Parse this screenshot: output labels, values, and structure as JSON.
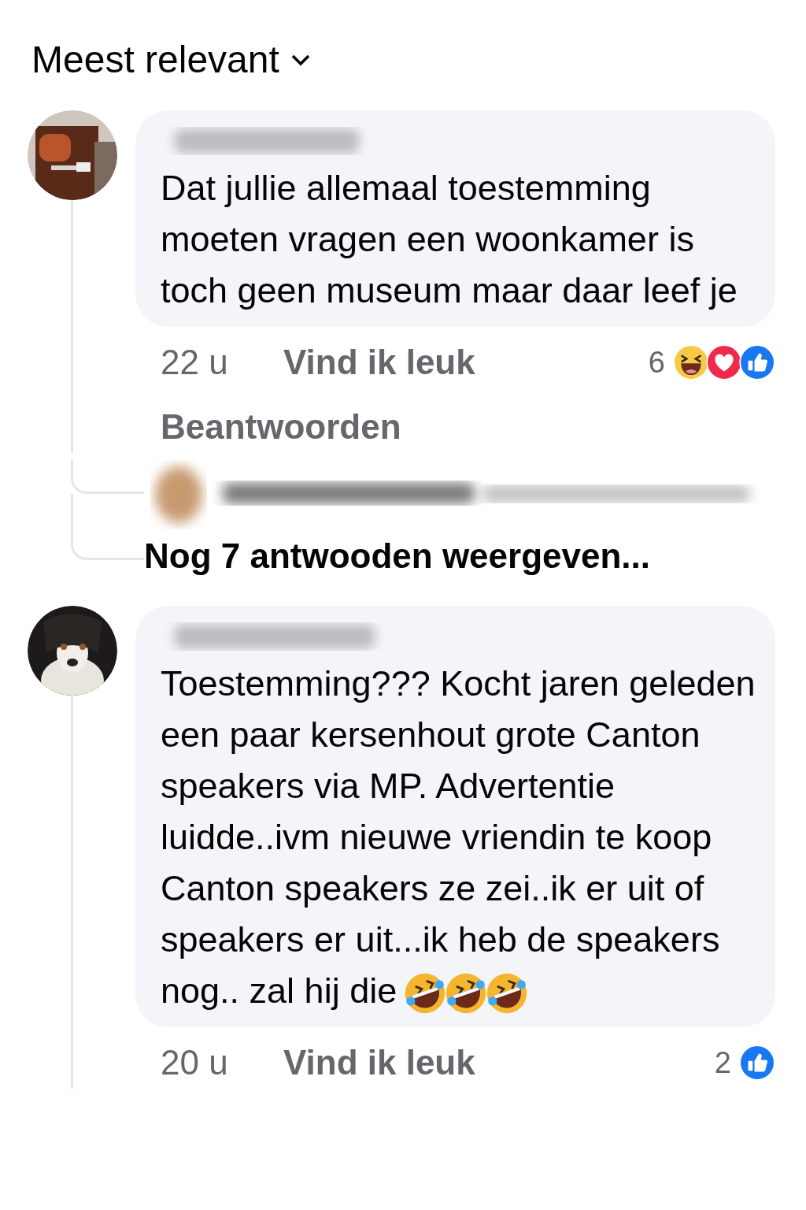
{
  "sort": {
    "label": "Meest relevant"
  },
  "comments": [
    {
      "avatar": {
        "kind": "picture"
      },
      "text": "Dat jullie allemaal toestemming moeten vragen een woonkamer is toch geen museum maar daar leef je",
      "time": "22 u",
      "like_label": "Vind ik leuk",
      "reply_label": "Beantwoorden",
      "reaction_count": "6",
      "reactions": [
        {
          "kind": "haha"
        },
        {
          "kind": "love"
        },
        {
          "kind": "like"
        }
      ],
      "more_replies": "Nog 7 antwooden weergeven..."
    },
    {
      "avatar": {
        "kind": "picture"
      },
      "text": "Toestemming??? Kocht jaren geleden een paar kersenhout grote Canton speakers via MP. Advertentie luidde..ivm nieuwe vriendin te koop Canton speakers ze zei..ik er uit of speakers er uit...ik heb de speakers nog.. zal hij die",
      "trailing_emojis": [
        {
          "kind": "rofl"
        },
        {
          "kind": "rofl"
        },
        {
          "kind": "rofl"
        }
      ],
      "time": "20 u",
      "like_label": "Vind ik leuk",
      "reaction_count": "2",
      "reactions": [
        {
          "kind": "like"
        }
      ]
    }
  ]
}
